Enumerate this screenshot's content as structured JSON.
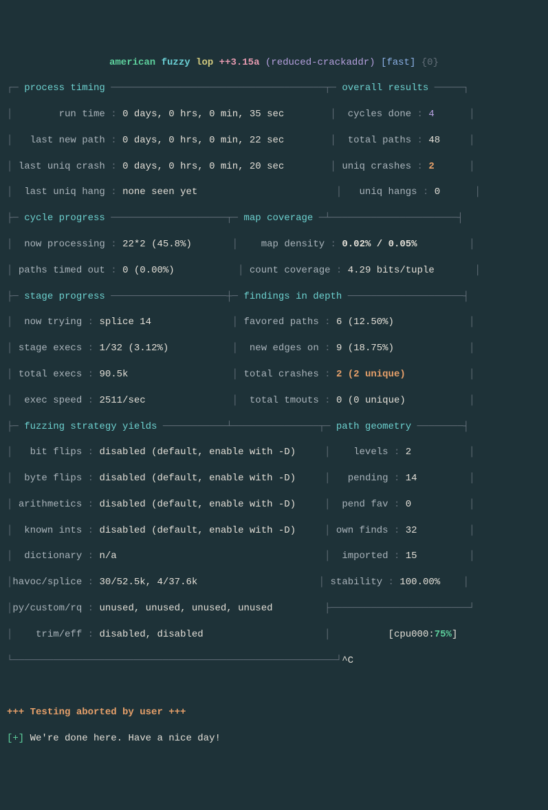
{
  "title": {
    "prefix": "american",
    "word2": "fuzzy",
    "word3": "lop",
    "version": "++3.15a",
    "target": "(reduced-crackaddr)",
    "mode": "[fast]",
    "instance": "{0}"
  },
  "sections": {
    "process_timing": "process timing",
    "overall_results": "overall results",
    "cycle_progress": "cycle progress",
    "map_coverage": "map coverage",
    "stage_progress": "stage progress",
    "findings_in_depth": "findings in depth",
    "fuzzing_strategy_yields": "fuzzing strategy yields",
    "path_geometry": "path geometry"
  },
  "labels": {
    "run_time": "run time",
    "last_new_path": "last new path",
    "last_uniq_crash": "last uniq crash",
    "last_uniq_hang": "last uniq hang",
    "cycles_done": "cycles done",
    "total_paths": "total paths",
    "uniq_crashes": "uniq crashes",
    "uniq_hangs": "uniq hangs",
    "now_processing": "now processing",
    "paths_timed_out": "paths timed out",
    "map_density": "map density",
    "count_coverage": "count coverage",
    "now_trying": "now trying",
    "stage_execs": "stage execs",
    "total_execs": "total execs",
    "exec_speed": "exec speed",
    "favored_paths": "favored paths",
    "new_edges_on": "new edges on",
    "total_crashes": "total crashes",
    "total_tmouts": "total tmouts",
    "bit_flips": "bit flips",
    "byte_flips": "byte flips",
    "arithmetics": "arithmetics",
    "known_ints": "known ints",
    "dictionary": "dictionary",
    "havoc_splice": "havoc/splice",
    "py_custom_rq": "py/custom/rq",
    "trim_eff": "trim/eff",
    "levels": "levels",
    "pending": "pending",
    "pend_fav": "pend fav",
    "own_finds": "own finds",
    "imported": "imported",
    "stability": "stability"
  },
  "values": {
    "run_time": "0 days, 0 hrs, 0 min, 35 sec",
    "last_new_path": "0 days, 0 hrs, 0 min, 22 sec",
    "last_uniq_crash": "0 days, 0 hrs, 0 min, 20 sec",
    "last_uniq_hang": "none seen yet",
    "cycles_done": "4",
    "total_paths": "48",
    "uniq_crashes": "2",
    "uniq_hangs": "0",
    "now_processing": "22*2 (45.8%)",
    "paths_timed_out": "0 (0.00%)",
    "map_density": "0.02% / 0.05%",
    "count_coverage": "4.29 bits/tuple",
    "now_trying": "splice 14",
    "stage_execs": "1/32 (3.12%)",
    "total_execs": "90.5k",
    "exec_speed": "2511/sec",
    "favored_paths": "6 (12.50%)",
    "new_edges_on": "9 (18.75%)",
    "total_crashes": "2 (2 unique)",
    "total_tmouts": "0 (0 unique)",
    "bit_flips": "disabled (default, enable with -D)",
    "byte_flips": "disabled (default, enable with -D)",
    "arithmetics": "disabled (default, enable with -D)",
    "known_ints": "disabled (default, enable with -D)",
    "dictionary": "n/a",
    "havoc_splice": "30/52.5k, 4/37.6k",
    "py_custom_rq": "unused, unused, unused, unused",
    "trim_eff": "disabled, disabled",
    "levels": "2",
    "pending": "14",
    "pend_fav": "0",
    "own_finds": "32",
    "imported": "15",
    "stability": "100.00%"
  },
  "footer": {
    "cpu_label": "cpu000:",
    "cpu_value": "75%",
    "interrupt": "^C",
    "abort_msg_prefix": "+++ ",
    "abort_msg": "Testing aborted by user +++",
    "done_prefix": "[+]",
    "done_msg": " We're done here. Have a nice day!"
  }
}
